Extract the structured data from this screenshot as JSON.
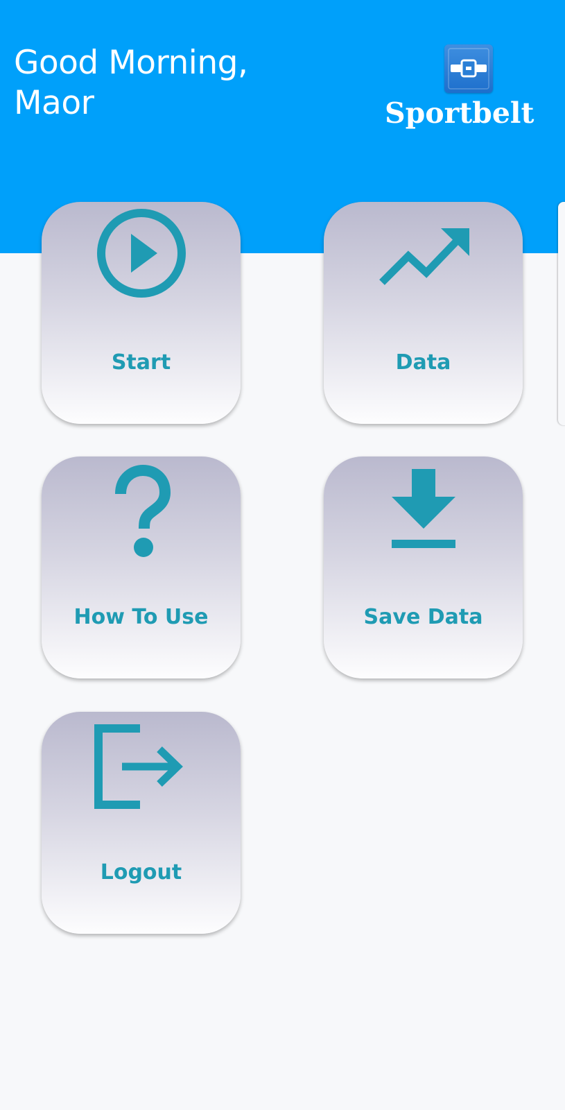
{
  "header": {
    "greeting_line1": "Good Morning,",
    "greeting_line2": "Maor",
    "brand_name": "Sportbelt",
    "background_color": "#00a0fa"
  },
  "menu": {
    "accent_color": "#1f9bb3",
    "items": [
      {
        "label": "Start",
        "icon": "play-circle-icon"
      },
      {
        "label": "Data",
        "icon": "trending-up-icon"
      },
      {
        "label": "How To Use",
        "icon": "question-mark-icon"
      },
      {
        "label": "Save Data",
        "icon": "download-icon"
      },
      {
        "label": "Logout",
        "icon": "logout-icon"
      }
    ]
  }
}
